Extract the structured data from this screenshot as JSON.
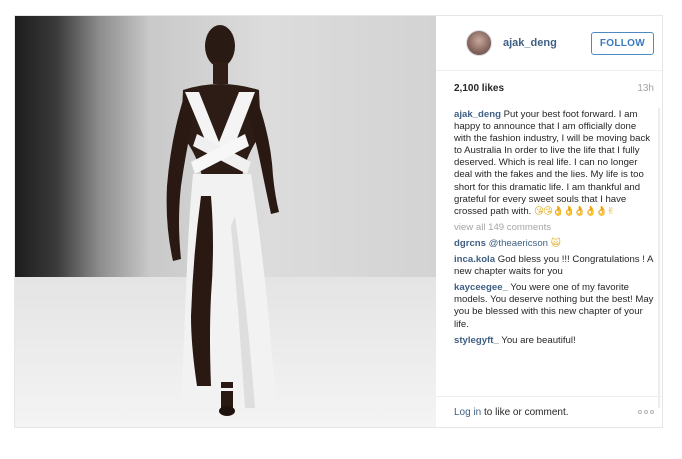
{
  "post": {
    "username": "ajak_deng",
    "follow_label": "FOLLOW",
    "likes": "2,100 likes",
    "time": "13h",
    "caption": {
      "user": "ajak_deng",
      "text": "Put your best foot forward. I am happy to announce that I am officially done with the fashion industry, I will be moving back to Australia In order to live the life that I fully deserved. Which is real life. I can no longer deal with the fakes and the lies. My life is too short for this dramatic life. I am thankful and grateful for every sweet souls that I have crossed path with.",
      "emoji": "😘😘👌👌👌👌👌✌"
    },
    "view_all": "view all 149 comments",
    "comments": [
      {
        "user": "dgrcns",
        "mention": "@theaericson",
        "text": "",
        "emoji": "🙀"
      },
      {
        "user": "inca.kola",
        "mention": "",
        "text": "God bless you !!! Congratulations ! A new chapter waits for you",
        "emoji": ""
      },
      {
        "user": "kayceegee_",
        "mention": "",
        "text": "You were one of my favorite models. You deserve nothing but the best! May you be blessed with this new chapter of your life.",
        "emoji": ""
      },
      {
        "user": "stylegyft_",
        "mention": "",
        "text": "You are beautiful!",
        "emoji": ""
      }
    ],
    "footer": {
      "login_link": "Log in",
      "login_rest": " to like or comment."
    }
  },
  "colors": {
    "username": "#3f5f83",
    "follow_border": "#4d8ac4",
    "muted": "#a5a5a5"
  },
  "icons": {
    "more": "more-options-icon"
  }
}
